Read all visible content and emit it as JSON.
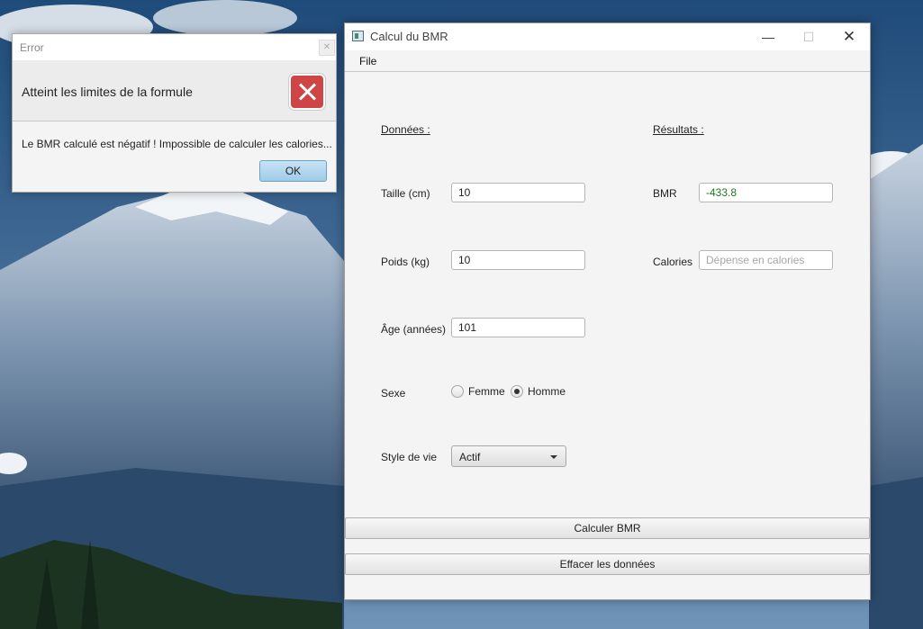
{
  "error_dialog": {
    "title": "Error",
    "header": "Atteint les limites de la formule",
    "message": "Le BMR calculé est négatif ! Impossible de calculer les calories...",
    "ok_label": "OK"
  },
  "window": {
    "title": "Calcul du BMR",
    "menu": [
      "File"
    ]
  },
  "form": {
    "donnees_header": "Données :",
    "resultats_header": "Résultats :",
    "taille_label": "Taille (cm)",
    "taille_value": "10",
    "poids_label": "Poids (kg)",
    "poids_value": "10",
    "age_label": "Âge (années)",
    "age_value": "101",
    "sexe_label": "Sexe",
    "sexe_options": [
      "Femme",
      "Homme"
    ],
    "sexe_selected": "Homme",
    "style_label": "Style de vie",
    "style_value": "Actif",
    "bmr_label": "BMR",
    "bmr_value": "-433.8",
    "bmr_color": "#1f7a1f",
    "calories_label": "Calories",
    "calories_placeholder": "Dépense en calories"
  },
  "buttons": {
    "calculer": "Calculer BMR",
    "effacer": "Effacer les données"
  }
}
